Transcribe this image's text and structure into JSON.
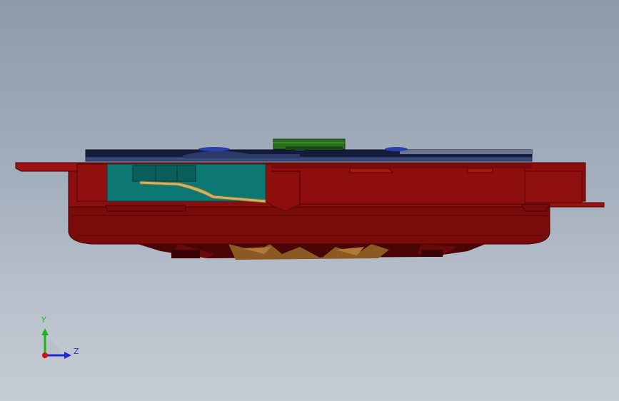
{
  "triad": {
    "y_label": "Y",
    "z_label": "Z",
    "colors": {
      "y_axis": "#19b419",
      "z_axis": "#1e2bd0",
      "x_axis": "#d01010"
    }
  },
  "model": {
    "colors": {
      "housing": "#8a0e0e",
      "housing_dark": "#5e0606",
      "pcb": "#0e7a78",
      "glass": "#141c3c",
      "connector": "#2b6e1e",
      "cable": "#c9b46a",
      "fan": "#8a5a22"
    }
  }
}
